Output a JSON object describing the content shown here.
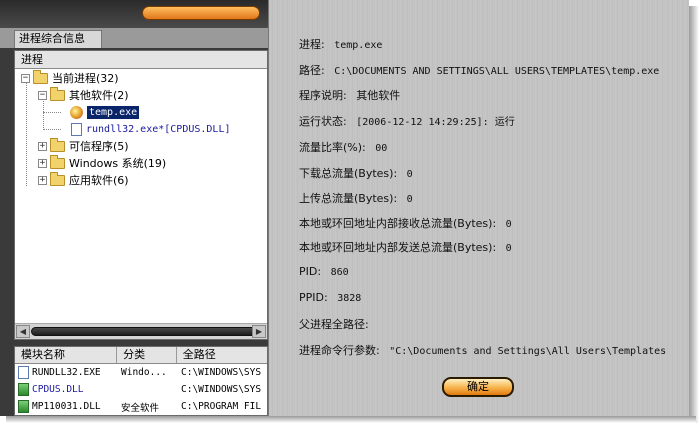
{
  "tabs": {
    "main": "进程综合信息"
  },
  "tree": {
    "header": "进程",
    "nodes": [
      {
        "id": "current",
        "label": "当前进程(32)",
        "expander": "−"
      },
      {
        "id": "other",
        "label": "其他软件(2)",
        "expander": "−"
      },
      {
        "id": "temp",
        "label": "temp.exe"
      },
      {
        "id": "rundll",
        "label": "rundll32.exe*[CPDUS.DLL]"
      },
      {
        "id": "trusted",
        "label": "可信程序(5)",
        "expander": "+"
      },
      {
        "id": "windows",
        "label": "Windows 系统(19)",
        "expander": "+"
      },
      {
        "id": "apps",
        "label": "应用软件(6)",
        "expander": "+"
      }
    ]
  },
  "scroll": {
    "left_arrow": "◀",
    "right_arrow": "▶"
  },
  "modules": {
    "headers": [
      "模块名称",
      "分类",
      "全路径"
    ],
    "rows": [
      {
        "name": "RUNDLL32.EXE",
        "category": "Windo...",
        "path": "C:\\WINDOWS\\SYS"
      },
      {
        "name": "CPDUS.DLL",
        "category": "",
        "path": "C:\\WINDOWS\\SYS"
      },
      {
        "name": "MP110031.DLL",
        "category": "安全软件",
        "path": "C:\\PROGRAM FIL"
      }
    ]
  },
  "details": {
    "process": {
      "label": "进程:",
      "value": "temp.exe"
    },
    "path": {
      "label": "路径:",
      "value": "C:\\DOCUMENTS AND SETTINGS\\ALL USERS\\TEMPLATES\\temp.exe"
    },
    "description": {
      "label": "程序说明:",
      "value": "其他软件"
    },
    "status": {
      "label": "运行状态:",
      "value": "[2006-12-12 14:29:25]: 运行"
    },
    "traffic_ratio": {
      "label": "流量比率(%):",
      "value": "00"
    },
    "download_total": {
      "label": "下载总流量(Bytes):",
      "value": "0"
    },
    "upload_total": {
      "label": "上传总流量(Bytes):",
      "value": "0"
    },
    "local_recv": {
      "label": "本地或环回地址内部接收总流量(Bytes):",
      "value": "0"
    },
    "local_send": {
      "label": "本地或环回地址内部发送总流量(Bytes):",
      "value": "0"
    },
    "pid": {
      "label": "PID:",
      "value": "860"
    },
    "ppid": {
      "label": "PPID:",
      "value": "3828"
    },
    "parent_path": {
      "label": "父进程全路径:",
      "value": ""
    },
    "cmdline": {
      "label": "进程命令行参数:",
      "value": "\"C:\\Documents and Settings\\All Users\\Templates"
    }
  },
  "ok_button": "确定"
}
